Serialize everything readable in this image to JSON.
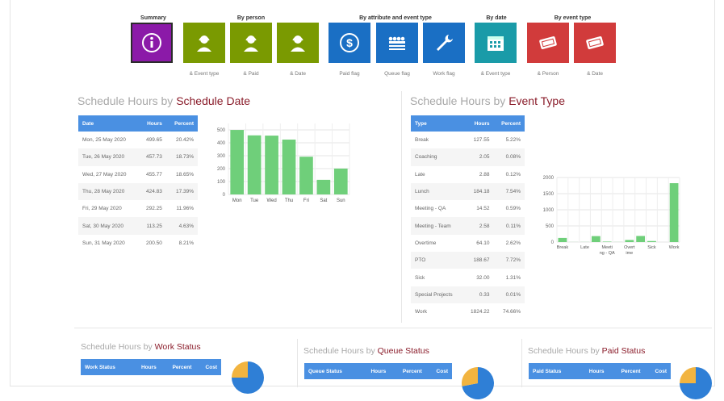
{
  "nav": {
    "groups": [
      {
        "label": "Summary"
      },
      {
        "label": "By person"
      },
      {
        "label": "By attribute and event type"
      },
      {
        "label": "By date"
      },
      {
        "label": "By event type"
      }
    ],
    "tiles": [
      {
        "icon": "info-icon",
        "caption": "",
        "color": "#8b1aa8",
        "selected": true
      },
      {
        "icon": "person-headset-icon",
        "caption": "& Event type",
        "color": "#7a9a01",
        "selected": false
      },
      {
        "icon": "person-headset-icon",
        "caption": "& Paid",
        "color": "#7a9a01",
        "selected": false
      },
      {
        "icon": "person-headset-icon",
        "caption": "& Date",
        "color": "#7a9a01",
        "selected": false
      },
      {
        "icon": "dollar-icon",
        "caption": "Paid flag",
        "color": "#1a6fc4",
        "selected": false
      },
      {
        "icon": "queue-icon",
        "caption": "Queue flag",
        "color": "#1a6fc4",
        "selected": false
      },
      {
        "icon": "wrench-icon",
        "caption": "Work flag",
        "color": "#1a6fc4",
        "selected": false
      },
      {
        "icon": "calendar-icon",
        "caption": "& Event type",
        "color": "#1a9ba8",
        "selected": false
      },
      {
        "icon": "ticket-icon",
        "caption": "& Person",
        "color": "#d13b3b",
        "selected": false
      },
      {
        "icon": "ticket-icon",
        "caption": "& Date",
        "color": "#d13b3b",
        "selected": false
      }
    ]
  },
  "schedule_date": {
    "title_prefix": "Schedule Hours by ",
    "title_highlight": "Schedule Date",
    "columns": [
      "Date",
      "Hours",
      "Percent"
    ],
    "rows": [
      [
        "Mon, 25 May 2020",
        "499.65",
        "20.42%"
      ],
      [
        "Tue, 26 May 2020",
        "457.73",
        "18.73%"
      ],
      [
        "Wed, 27 May 2020",
        "455.77",
        "18.65%"
      ],
      [
        "Thu, 28 May 2020",
        "424.83",
        "17.39%"
      ],
      [
        "Fri, 29 May 2020",
        "292.25",
        "11.96%"
      ],
      [
        "Sat, 30 May 2020",
        "113.25",
        "4.63%"
      ],
      [
        "Sun, 31 May 2020",
        "200.50",
        "8.21%"
      ]
    ]
  },
  "event_type": {
    "title_prefix": "Schedule Hours by ",
    "title_highlight": "Event Type",
    "columns": [
      "Type",
      "Hours",
      "Percent"
    ],
    "rows": [
      [
        "Break",
        "127.55",
        "5.22%"
      ],
      [
        "Coaching",
        "2.05",
        "0.08%"
      ],
      [
        "Late",
        "2.88",
        "0.12%"
      ],
      [
        "Lunch",
        "184.18",
        "7.54%"
      ],
      [
        "Meeting - QA",
        "14.52",
        "0.59%"
      ],
      [
        "Meeting - Team",
        "2.58",
        "0.11%"
      ],
      [
        "Overtime",
        "64.10",
        "2.62%"
      ],
      [
        "PTO",
        "188.67",
        "7.72%"
      ],
      [
        "Sick",
        "32.00",
        "1.31%"
      ],
      [
        "Special Projects",
        "0.33",
        "0.01%"
      ],
      [
        "Work",
        "1824.22",
        "74.66%"
      ]
    ]
  },
  "work_status": {
    "title_prefix": "Schedule Hours by ",
    "title_highlight": "Work Status",
    "columns": [
      "Work Status",
      "Hours",
      "Percent",
      "Cost"
    ]
  },
  "queue_status": {
    "title_prefix": "Schedule Hours by ",
    "title_highlight": "Queue Status",
    "columns": [
      "Queue Status",
      "Hours",
      "Percent",
      "Cost"
    ]
  },
  "paid_status": {
    "title_prefix": "Schedule Hours by ",
    "title_highlight": "Paid Status",
    "columns": [
      "Paid Status",
      "Hours",
      "Percent",
      "Cost"
    ]
  },
  "chart_data": [
    {
      "type": "bar",
      "categories": [
        "Mon",
        "Tue",
        "Wed",
        "Thu",
        "Fri",
        "Sat",
        "Sun"
      ],
      "values": [
        499.65,
        457.73,
        455.77,
        424.83,
        292.25,
        113.25,
        200.5
      ],
      "ylim": [
        0,
        550
      ],
      "yticks": [
        "500",
        "400",
        "300",
        "200",
        "100",
        "0"
      ],
      "color": "#6fcf7a",
      "grid": true
    },
    {
      "type": "bar",
      "categories": [
        "Break",
        "Late",
        "Meeting - QA",
        "Overtime",
        "Sick",
        "Work"
      ],
      "values": [
        127.55,
        2.88,
        184.18,
        14.52,
        64.1,
        188.67,
        32.0,
        1824.22
      ],
      "category_values": [
        127.55,
        2.05,
        2.88,
        184.18,
        14.52,
        2.58,
        64.1,
        188.67,
        32.0,
        0.33,
        1824.22
      ],
      "ylim": [
        0,
        2000
      ],
      "yticks": [
        "2000",
        "1500",
        "1000",
        "500",
        "0"
      ],
      "color": "#6fcf7a",
      "grid": true
    },
    {
      "type": "pie",
      "values": [
        75,
        25
      ],
      "colors": [
        "#2f7fd6",
        "#f2b440"
      ]
    },
    {
      "type": "pie",
      "values": [
        72,
        28
      ],
      "colors": [
        "#2f7fd6",
        "#f2b440"
      ]
    },
    {
      "type": "pie",
      "values": [
        75,
        25
      ],
      "colors": [
        "#2f7fd6",
        "#f2b440"
      ]
    }
  ]
}
